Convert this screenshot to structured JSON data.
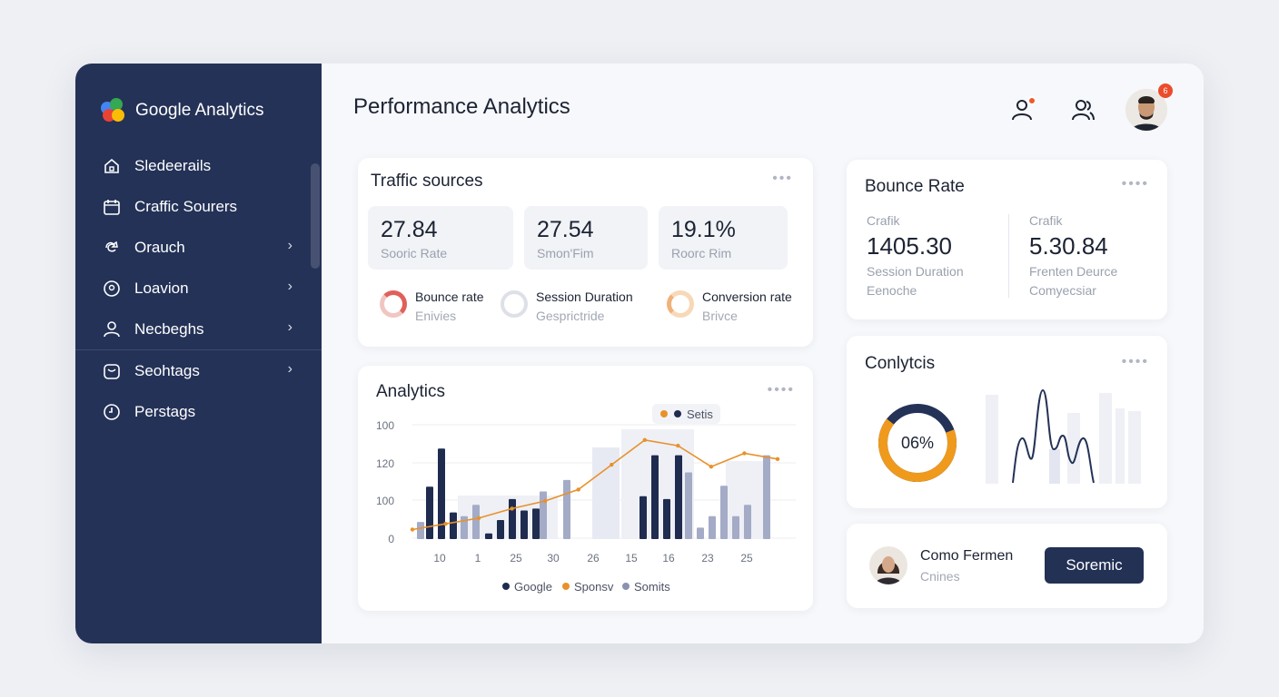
{
  "sidebar": {
    "brand": "Google Analytics",
    "items": [
      {
        "label": "Sledeerails",
        "icon": "home-icon",
        "chevron": false
      },
      {
        "label": "Craffic Sourers",
        "icon": "calendar-icon",
        "chevron": false
      },
      {
        "label": "Orauch",
        "icon": "share-icon",
        "chevron": true
      },
      {
        "label": "Loavion",
        "icon": "location-icon",
        "chevron": true
      },
      {
        "label": "Necbeghs",
        "icon": "user-icon",
        "chevron": true
      },
      {
        "label": "Seohtags",
        "icon": "tag-icon",
        "chevron": true
      },
      {
        "label": "Perstags",
        "icon": "clock-icon",
        "chevron": false
      }
    ]
  },
  "header": {
    "title": "Performance Analytics",
    "avatar_badge": "6"
  },
  "traffic": {
    "title": "Traffic sources",
    "stats": [
      {
        "value": "27.84",
        "label": "Sooric Rate"
      },
      {
        "value": "27.54",
        "label": "Smon'Fim"
      },
      {
        "value": "19.1%",
        "label": "Roorc Rim"
      }
    ],
    "legend": [
      {
        "label": "Bounce rate",
        "sub": "Enivies",
        "color": "#e0605a"
      },
      {
        "label": "Session Duration",
        "sub": "Gesprictride",
        "color": "#c9cdd6"
      },
      {
        "label": "Conversion rate",
        "sub": "Brivce",
        "color": "#f0b27a"
      }
    ]
  },
  "analytics": {
    "title": "Analytics",
    "badge": "Setis",
    "legend": [
      {
        "label": "Google",
        "color": "#1f2c4f"
      },
      {
        "label": "Sponsv",
        "color": "#e8912b"
      },
      {
        "label": "Somits",
        "color": "#8a92b0"
      }
    ]
  },
  "chart_data": {
    "type": "bar",
    "yticks": [
      "100",
      "120",
      "100",
      "0"
    ],
    "xticks": [
      "10",
      "1",
      "25",
      "30",
      "26",
      "15",
      "16",
      "23",
      "25"
    ],
    "series": [
      {
        "name": "Google",
        "values": [
          55,
          95,
          28,
          6,
          20,
          42,
          30,
          32,
          45,
          88,
          42,
          88
        ]
      },
      {
        "name": "Sponsv",
        "values": [
          10,
          16,
          22,
          32,
          40,
          52,
          78,
          104,
          98,
          76,
          90,
          84
        ]
      },
      {
        "name": "Somits",
        "values": [
          18,
          24,
          36,
          50,
          62,
          70,
          12,
          24,
          56,
          24,
          36,
          88
        ]
      }
    ]
  },
  "bounce": {
    "title": "Bounce Rate",
    "col1": {
      "label": "Crafik",
      "value": "1405.30",
      "sub1": "Session Duration",
      "sub2": "Eenoche"
    },
    "col2": {
      "label": "Crafik",
      "value": "5.30.84",
      "sub1": "Frenten Deurce",
      "sub2": "Comyecsiar"
    }
  },
  "conlytcis": {
    "title": "Conlytcis",
    "donut_value": "06%",
    "donut_fraction": 0.66
  },
  "profile": {
    "name": "Como Fermen",
    "sub": "Cnines",
    "button": "Soremic"
  }
}
